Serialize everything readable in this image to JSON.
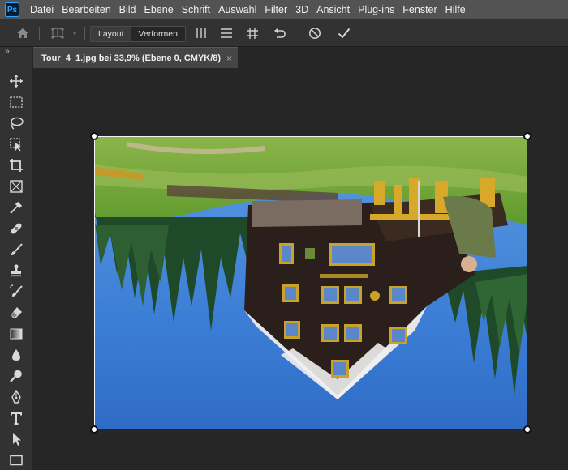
{
  "app": {
    "logo_text": "Ps"
  },
  "menubar": {
    "items": [
      "Datei",
      "Bearbeiten",
      "Bild",
      "Ebene",
      "Schrift",
      "Auswahl",
      "Filter",
      "3D",
      "Ansicht",
      "Plug-ins",
      "Fenster",
      "Hilfe"
    ]
  },
  "optionsbar": {
    "mode_layout": "Layout",
    "mode_verformen": "Verformen",
    "icons": [
      "home-icon",
      "warp-mesh-icon",
      "split-vertical-icon",
      "split-horizontal-icon",
      "grid-icon",
      "undo-warp-icon",
      "cancel-icon",
      "commit-icon"
    ]
  },
  "toolbar": {
    "collapse_glyph": "››",
    "tools": [
      "move",
      "marquee",
      "lasso",
      "object-selection",
      "crop",
      "frame",
      "eyedropper",
      "healing-brush",
      "brush",
      "clone-stamp",
      "history-brush",
      "eraser",
      "gradient",
      "blur",
      "dodge",
      "pen",
      "type",
      "path-selection",
      "rectangle"
    ]
  },
  "document": {
    "tab_title": "Tour_4_1.jpg bei 33,9% (Ebene 0, CMYK/8)",
    "tab_close": "×"
  },
  "colors": {
    "menubar_bg": "#535353",
    "panel_bg": "#323232",
    "canvas_bg": "#262626",
    "tab_bg": "#454545",
    "ps_blue": "#31a8ff"
  }
}
